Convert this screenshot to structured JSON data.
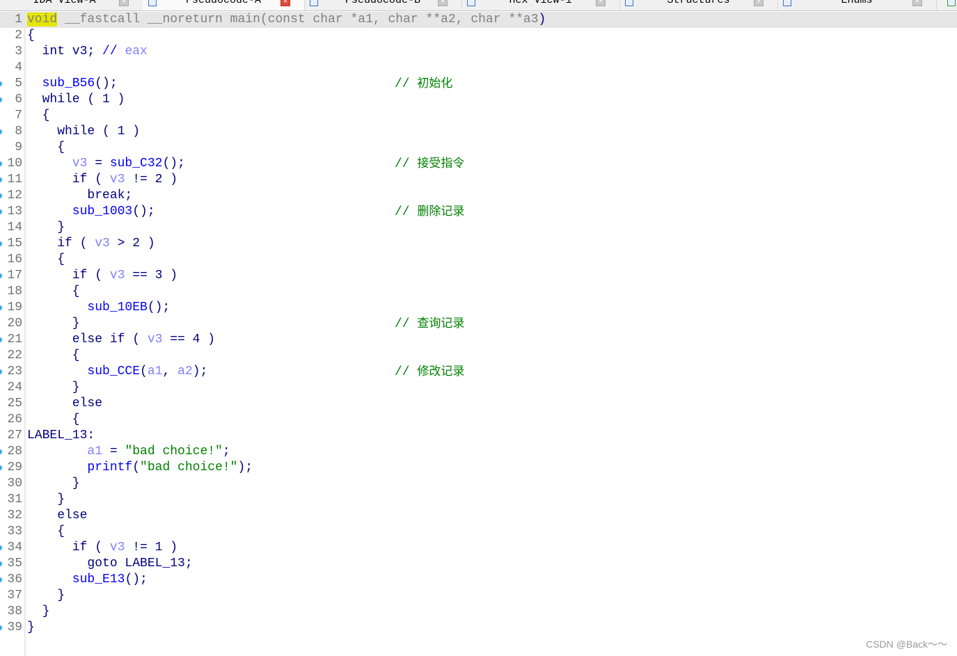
{
  "tabs": [
    {
      "label": "IDA View-A",
      "active": false
    },
    {
      "label": "Pseudocode-A",
      "active": true
    },
    {
      "label": "Pseudocode-B",
      "active": false
    },
    {
      "label": "Hex View-1",
      "active": false
    },
    {
      "label": "Structures",
      "active": false
    },
    {
      "label": "Enums",
      "active": false
    }
  ],
  "colors": {
    "keyword": "#000080",
    "function": "#0000ff",
    "variable": "#8080ff",
    "string": "#008000",
    "comment": "#008000",
    "highlight": "#e6e600",
    "breakpoint_dot": "#39a9e8"
  },
  "lines": [
    {
      "n": "1",
      "dot": false,
      "cur": true,
      "t": [
        [
          "hl",
          "void"
        ],
        [
          "g",
          " __fastcall __noreturn main(const char *a1, char **a2, char **a3"
        ],
        [
          "p",
          ")"
        ]
      ]
    },
    {
      "n": "2",
      "dot": false,
      "t": [
        [
          "p",
          "{"
        ]
      ]
    },
    {
      "n": "3",
      "dot": false,
      "t": [
        [
          "k",
          "  int v3; "
        ],
        [
          "f",
          "// "
        ],
        [
          "v",
          "eax"
        ]
      ]
    },
    {
      "n": "4",
      "dot": false,
      "t": []
    },
    {
      "n": "5",
      "dot": true,
      "t": [
        [
          "f",
          "  sub_B56"
        ],
        [
          "k",
          "();"
        ]
      ],
      "c": "初始化"
    },
    {
      "n": "6",
      "dot": true,
      "t": [
        [
          "k",
          "  while ( 1 )"
        ]
      ]
    },
    {
      "n": "7",
      "dot": false,
      "t": [
        [
          "k",
          "  {"
        ]
      ]
    },
    {
      "n": "8",
      "dot": true,
      "t": [
        [
          "k",
          "    while ( 1 )"
        ]
      ]
    },
    {
      "n": "9",
      "dot": false,
      "t": [
        [
          "k",
          "    {"
        ]
      ]
    },
    {
      "n": "10",
      "dot": true,
      "t": [
        [
          "v",
          "      v3"
        ],
        [
          "k",
          " = "
        ],
        [
          "f",
          "sub_C32"
        ],
        [
          "k",
          "();"
        ]
      ],
      "c": "接受指令"
    },
    {
      "n": "11",
      "dot": true,
      "t": [
        [
          "k",
          "      if ( "
        ],
        [
          "v",
          "v3"
        ],
        [
          "k",
          " != 2 )"
        ]
      ]
    },
    {
      "n": "12",
      "dot": true,
      "t": [
        [
          "k",
          "        break;"
        ]
      ]
    },
    {
      "n": "13",
      "dot": true,
      "t": [
        [
          "f",
          "      sub_1003"
        ],
        [
          "k",
          "();"
        ]
      ],
      "c": "删除记录"
    },
    {
      "n": "14",
      "dot": false,
      "t": [
        [
          "k",
          "    }"
        ]
      ]
    },
    {
      "n": "15",
      "dot": true,
      "t": [
        [
          "k",
          "    if ( "
        ],
        [
          "v",
          "v3"
        ],
        [
          "k",
          " > 2 )"
        ]
      ]
    },
    {
      "n": "16",
      "dot": false,
      "t": [
        [
          "k",
          "    {"
        ]
      ]
    },
    {
      "n": "17",
      "dot": true,
      "t": [
        [
          "k",
          "      if ( "
        ],
        [
          "v",
          "v3"
        ],
        [
          "k",
          " == 3 )"
        ]
      ]
    },
    {
      "n": "18",
      "dot": false,
      "t": [
        [
          "k",
          "      {"
        ]
      ]
    },
    {
      "n": "19",
      "dot": true,
      "t": [
        [
          "f",
          "        sub_10EB"
        ],
        [
          "k",
          "();"
        ]
      ]
    },
    {
      "n": "20",
      "dot": false,
      "t": [
        [
          "k",
          "      }"
        ]
      ],
      "c": "查询记录"
    },
    {
      "n": "21",
      "dot": true,
      "t": [
        [
          "k",
          "      else if ( "
        ],
        [
          "v",
          "v3"
        ],
        [
          "k",
          " == 4 )"
        ]
      ]
    },
    {
      "n": "22",
      "dot": false,
      "t": [
        [
          "k",
          "      {"
        ]
      ]
    },
    {
      "n": "23",
      "dot": true,
      "t": [
        [
          "f",
          "        sub_CCE"
        ],
        [
          "k",
          "("
        ],
        [
          "v",
          "a1"
        ],
        [
          "k",
          ", "
        ],
        [
          "v",
          "a2"
        ],
        [
          "k",
          ");"
        ]
      ],
      "c": "修改记录"
    },
    {
      "n": "24",
      "dot": false,
      "t": [
        [
          "k",
          "      }"
        ]
      ]
    },
    {
      "n": "25",
      "dot": false,
      "t": [
        [
          "k",
          "      else"
        ]
      ]
    },
    {
      "n": "26",
      "dot": false,
      "t": [
        [
          "k",
          "      {"
        ]
      ]
    },
    {
      "n": "27",
      "dot": false,
      "t": [
        [
          "k",
          "LABEL_13:"
        ]
      ]
    },
    {
      "n": "28",
      "dot": true,
      "t": [
        [
          "v",
          "        a1"
        ],
        [
          "k",
          " = "
        ],
        [
          "s",
          "\"bad choice!\""
        ],
        [
          "k",
          ";"
        ]
      ]
    },
    {
      "n": "29",
      "dot": true,
      "t": [
        [
          "f",
          "        printf"
        ],
        [
          "k",
          "("
        ],
        [
          "s",
          "\"bad choice!\""
        ],
        [
          "k",
          ");"
        ]
      ]
    },
    {
      "n": "30",
      "dot": false,
      "t": [
        [
          "k",
          "      }"
        ]
      ]
    },
    {
      "n": "31",
      "dot": false,
      "t": [
        [
          "k",
          "    }"
        ]
      ]
    },
    {
      "n": "32",
      "dot": false,
      "t": [
        [
          "k",
          "    else"
        ]
      ]
    },
    {
      "n": "33",
      "dot": false,
      "t": [
        [
          "k",
          "    {"
        ]
      ]
    },
    {
      "n": "34",
      "dot": true,
      "t": [
        [
          "k",
          "      if ( "
        ],
        [
          "v",
          "v3"
        ],
        [
          "k",
          " != 1 )"
        ]
      ]
    },
    {
      "n": "35",
      "dot": true,
      "t": [
        [
          "k",
          "        goto LABEL_13;"
        ]
      ]
    },
    {
      "n": "36",
      "dot": true,
      "t": [
        [
          "f",
          "      sub_E13"
        ],
        [
          "k",
          "();"
        ]
      ]
    },
    {
      "n": "37",
      "dot": false,
      "t": [
        [
          "k",
          "    }"
        ]
      ]
    },
    {
      "n": "38",
      "dot": false,
      "t": [
        [
          "k",
          "  }"
        ]
      ]
    },
    {
      "n": "39",
      "dot": true,
      "t": [
        [
          "p",
          "}"
        ]
      ]
    }
  ],
  "comment_prefix": "// ",
  "watermark": "CSDN @Back～～"
}
